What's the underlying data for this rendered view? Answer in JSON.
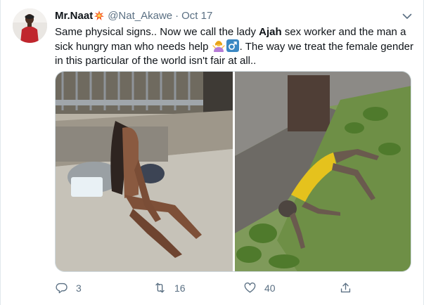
{
  "tweet": {
    "author": {
      "name": "Mr.Naat",
      "handle": "@Nat_Akawe",
      "separator": "·",
      "date": "Oct 17"
    },
    "text": {
      "part1": "Same physical signs.. Now we call the lady ",
      "bold": "Ajah",
      "part2": " sex worker and the man a sick hungry man who needs help",
      "part3": ". The way we treat the female gender in this particular  of the world isn't fair at all.."
    },
    "media": [
      {
        "icon": "photo-woman-sitting"
      },
      {
        "icon": "photo-man-lying-yellow-shirt"
      }
    ],
    "actions": {
      "reply_count": "3",
      "retweet_count": "16",
      "like_count": "40"
    },
    "colors": {
      "secondary_text": "#5b7083",
      "text": "#0f1419",
      "border": "#cfd9de"
    }
  }
}
